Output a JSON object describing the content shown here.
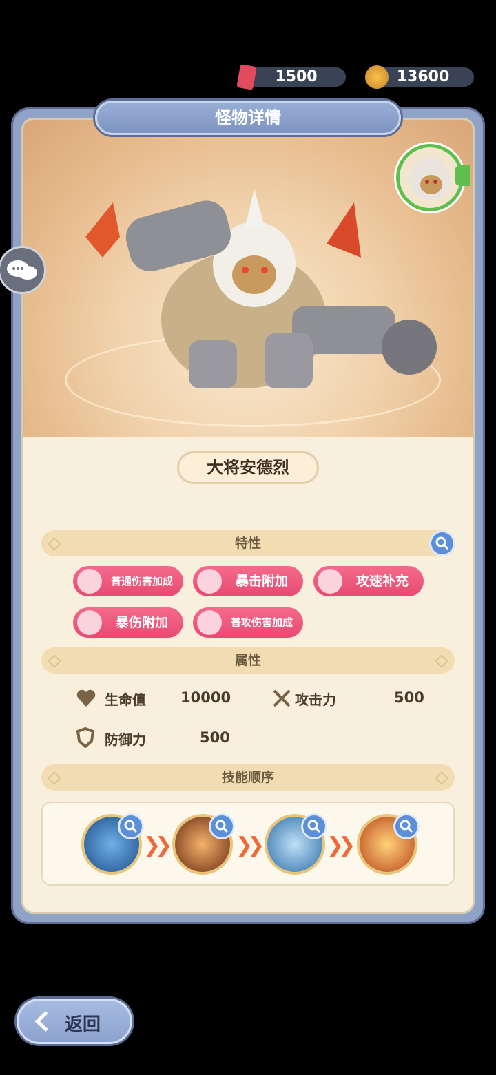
{
  "currency": {
    "tickets": "1500",
    "coins": "13600"
  },
  "panel": {
    "title": "怪物详情",
    "monster_name": "大将安德烈"
  },
  "sections": {
    "traits": "特性",
    "attributes": "属性",
    "skill_order": "技能顺序"
  },
  "traits": [
    {
      "label": "普通伤害加成",
      "icon": "sword-icon"
    },
    {
      "label": "暴击附加",
      "icon": "crit-burst-icon"
    },
    {
      "label": "攻速补充",
      "icon": "sword-icon"
    },
    {
      "label": "暴伤附加",
      "icon": "crit-burst-icon"
    },
    {
      "label": "普攻伤害加成",
      "icon": "sword-icon"
    }
  ],
  "attributes": {
    "hp_label": "生命值",
    "hp_value": "10000",
    "atk_label": "攻击力",
    "atk_value": "500",
    "def_label": "防御力",
    "def_value": "500"
  },
  "skills": [
    {
      "icon": "wolf-howl-icon",
      "color": "#3b79b8"
    },
    {
      "icon": "fire-swirl-icon",
      "color": "#c8561f"
    },
    {
      "icon": "ice-wolf-icon",
      "color": "#4b8fc9"
    },
    {
      "icon": "crack-explosion-icon",
      "color": "#d9621f"
    }
  ],
  "back_button": "返回",
  "colors": {
    "trait_pink": "#e84a71",
    "panel_blue": "#8fa3c7",
    "parchment": "#f8efdc",
    "search_blue": "#5b8fd8"
  }
}
